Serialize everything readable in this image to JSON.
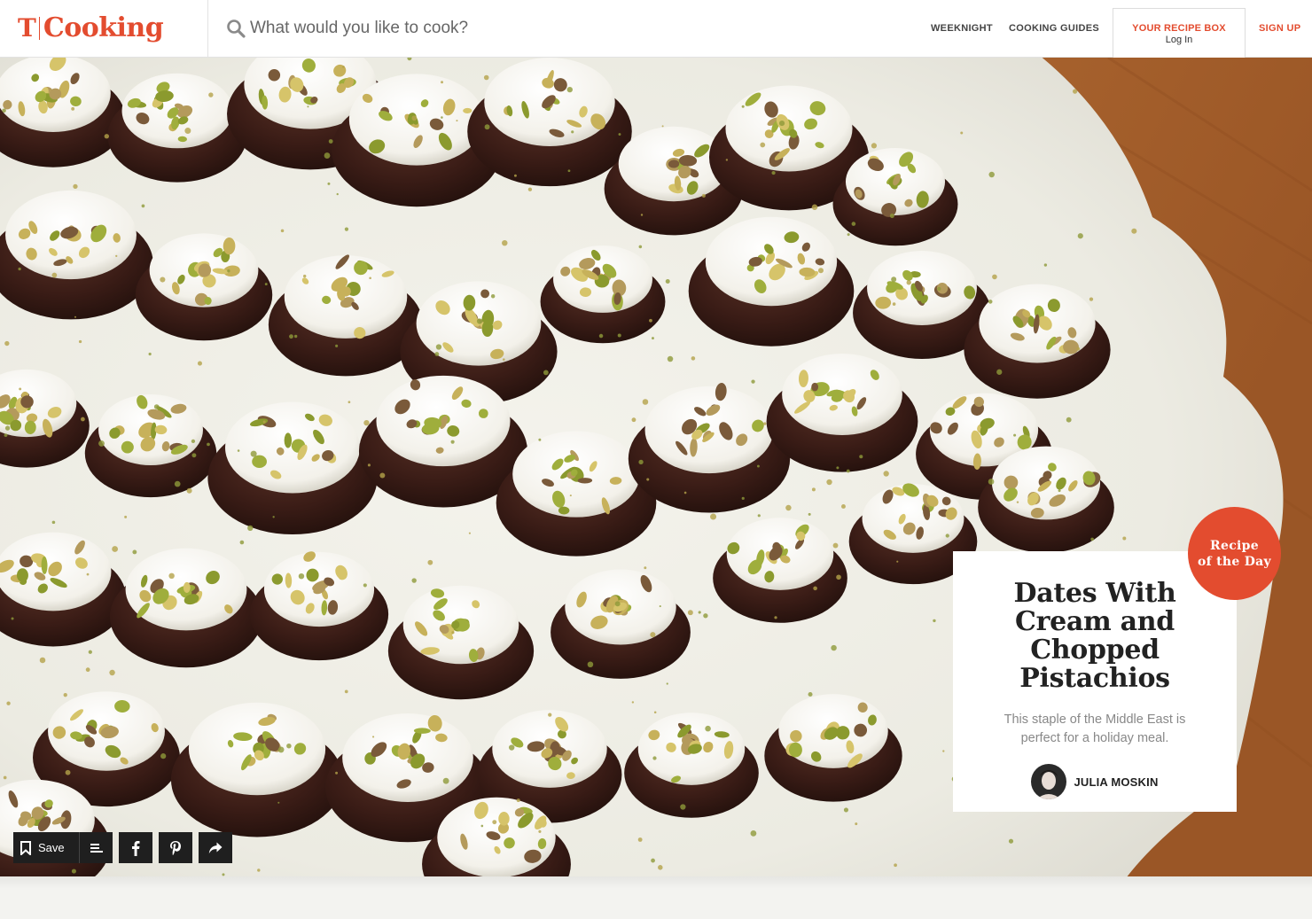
{
  "header": {
    "logo_mark": "T",
    "logo_text": "Cooking",
    "search_placeholder": "What would you like to cook?",
    "nav": {
      "weeknight": "WEEKNIGHT",
      "cooking_guides": "COOKING GUIDES",
      "recipe_box": "YOUR RECIPE BOX",
      "login": "Log In",
      "signup": "SIGN UP"
    }
  },
  "recipe": {
    "badge_line1": "Recipe",
    "badge_line2": "of the Day",
    "title": "Dates With Cream and Chopped Pistachios",
    "description": "This staple of the Middle East is perfect for a holiday meal.",
    "author": "JULIA MOSKIN"
  },
  "actions": {
    "save_label": "Save",
    "icons": [
      "bookmark-icon",
      "list-icon",
      "facebook-icon",
      "pinterest-icon",
      "share-icon"
    ]
  },
  "colors": {
    "brand": "#e34c2f",
    "button_dark": "#1f1f1f"
  }
}
